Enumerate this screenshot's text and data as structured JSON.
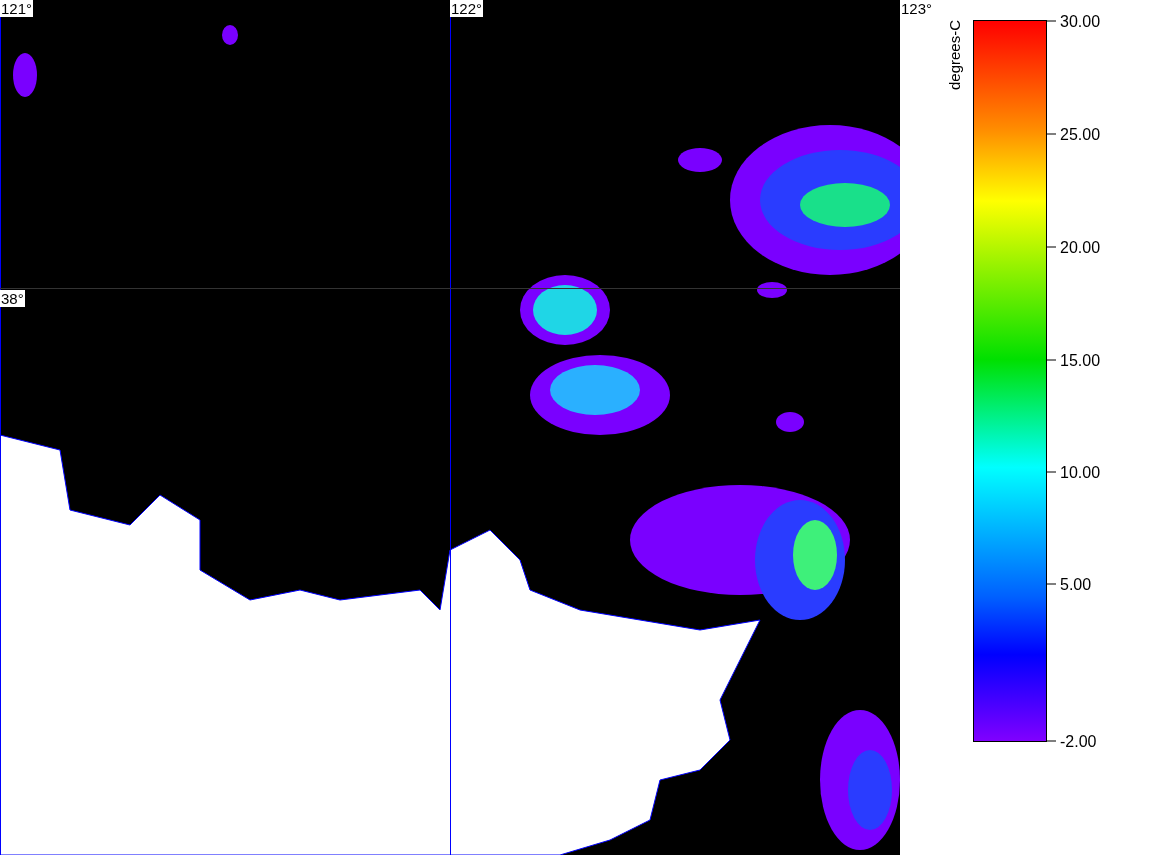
{
  "map": {
    "longitude_labels": [
      "121°",
      "122°",
      "123°"
    ],
    "latitude_labels": [
      "38°"
    ]
  },
  "colorbar": {
    "unit": "degrees-C",
    "ticks": [
      "30.00",
      "25.00",
      "20.00",
      "15.00",
      "10.00",
      "5.00",
      "-2.00"
    ]
  }
}
